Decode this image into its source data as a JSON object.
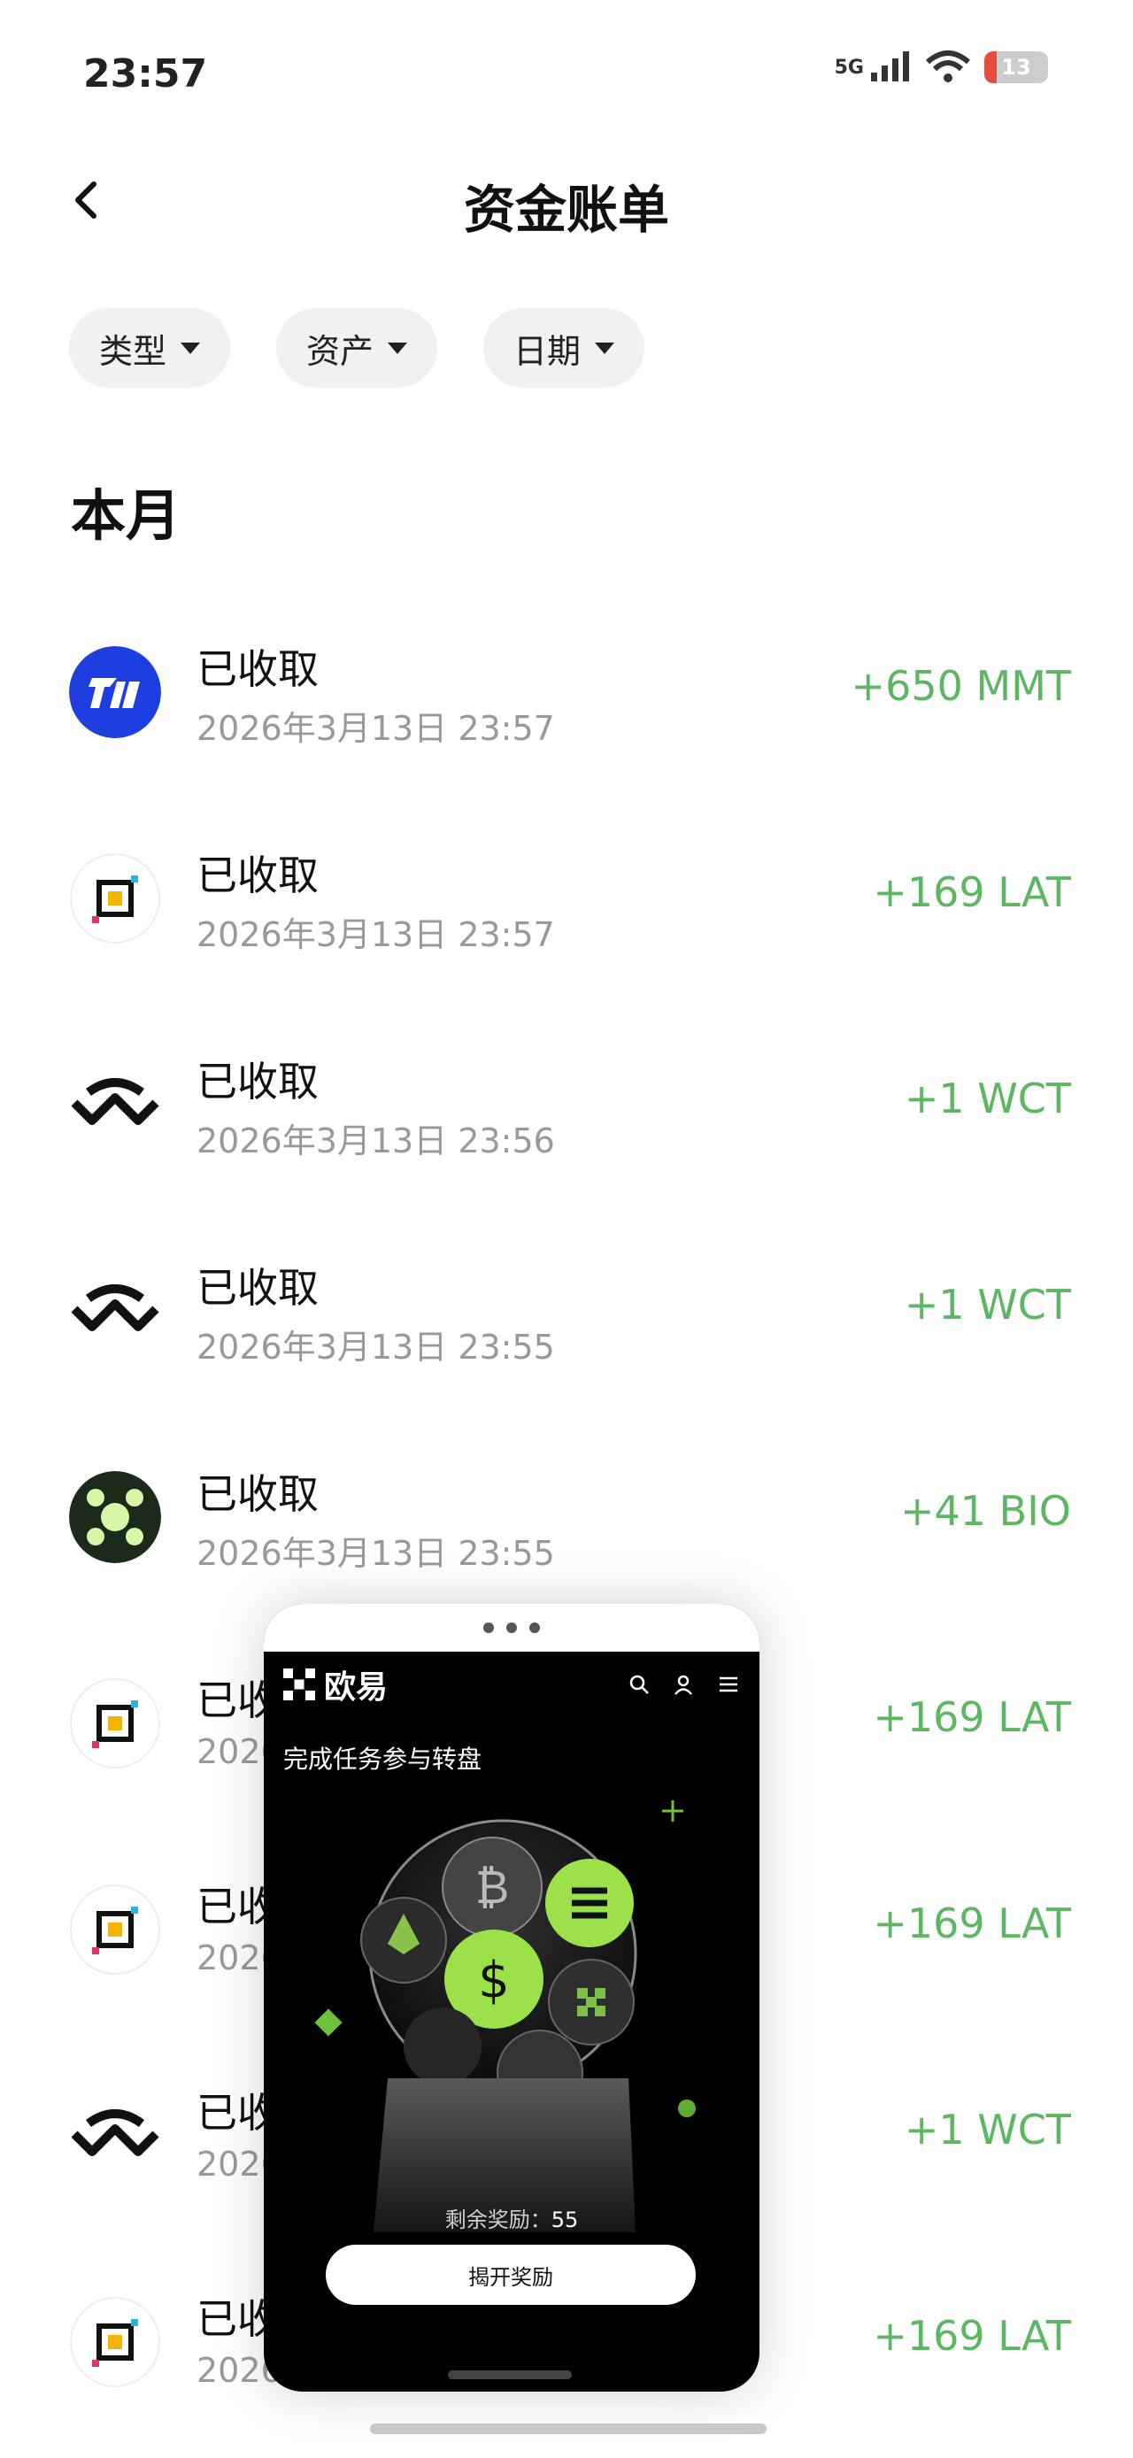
{
  "status_bar": {
    "time": "23:57",
    "network": "5G",
    "battery": "13"
  },
  "header": {
    "title": "资金账单"
  },
  "filters": [
    {
      "label": "类型"
    },
    {
      "label": "资产"
    },
    {
      "label": "日期"
    }
  ],
  "section": {
    "title": "本月"
  },
  "transactions": [
    {
      "icon": "mmt-logo-icon",
      "label": "已收取",
      "date": "2026年3月13日 23:57",
      "amount": "+650 MMT"
    },
    {
      "icon": "lat-logo-icon",
      "label": "已收取",
      "date": "2026年3月13日 23:57",
      "amount": "+169 LAT"
    },
    {
      "icon": "wct-logo-icon",
      "label": "已收取",
      "date": "2026年3月13日 23:56",
      "amount": "+1 WCT"
    },
    {
      "icon": "wct-logo-icon",
      "label": "已收取",
      "date": "2026年3月13日 23:55",
      "amount": "+1 WCT"
    },
    {
      "icon": "bio-logo-icon",
      "label": "已收取",
      "date": "2026年3月13日 23:55",
      "amount": "+41 BIO"
    },
    {
      "icon": "lat-logo-icon",
      "label": "已收",
      "date": "2026",
      "amount": "+169 LAT"
    },
    {
      "icon": "lat-logo-icon",
      "label": "已收",
      "date": "2026",
      "amount": "+169 LAT"
    },
    {
      "icon": "wct-logo-icon",
      "label": "已收",
      "date": "2026",
      "amount": "+1 WCT"
    },
    {
      "icon": "lat-logo-icon",
      "label": "已收",
      "date": "2026",
      "amount": "+169 LAT"
    }
  ],
  "popup": {
    "brand": "欧易",
    "title": "完成任务参与转盘",
    "remaining_label": "剩余奖励：",
    "remaining_value": "55",
    "button": "揭开奖励"
  },
  "colors": {
    "positive": "#5cb860",
    "chip_bg": "#f1f1f1",
    "popup_bg": "#000000"
  }
}
